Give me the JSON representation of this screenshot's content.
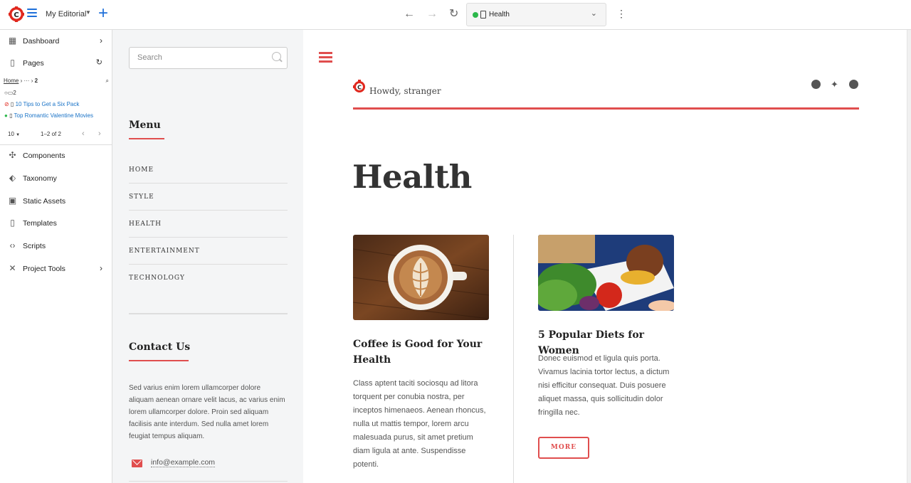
{
  "toolbar": {
    "site_name": "My Editorial",
    "address_label": "Health"
  },
  "sidebar": {
    "items": [
      {
        "label": "Dashboard"
      },
      {
        "label": "Pages"
      },
      {
        "label": "Components"
      },
      {
        "label": "Taxonomy"
      },
      {
        "label": "Static Assets"
      },
      {
        "label": "Templates"
      },
      {
        "label": "Scripts"
      },
      {
        "label": "Project Tools"
      }
    ],
    "breadcrumb": {
      "home": "Home",
      "ellipsis": "···",
      "current": "2"
    },
    "tree": {
      "folder": "2",
      "pages": [
        "10 Tips to Get a Six Pack",
        "Top Romantic Valentine Movies"
      ]
    },
    "pager": {
      "per_page": "10",
      "range": "1–2 of 2"
    }
  },
  "site": {
    "search_placeholder": "Search",
    "menu_title": "Menu",
    "menu_items": [
      "HOME",
      "STYLE",
      "HEALTH",
      "ENTERTAINMENT",
      "TECHNOLOGY"
    ],
    "contact_title": "Contact Us",
    "contact_text": "Sed varius enim lorem ullamcorper dolore aliquam aenean ornare velit lacus, ac varius enim lorem ullamcorper dolore. Proin sed aliquam facilisis ante interdum. Sed nulla amet lorem feugiat tempus aliquam.",
    "email": "info@example.com",
    "greeting": "Howdy, stranger",
    "page_title": "Health",
    "articles": [
      {
        "title": "Coffee is Good for Your Health",
        "body": "Class aptent taciti sociosqu ad litora torquent per conubia nostra, per inceptos himenaeos. Aenean rhoncus, nulla ut mattis tempor, lorem arcu malesuada purus, sit amet pretium diam ligula at ante. Suspendisse potenti."
      },
      {
        "title": "5 Popular Diets for Women",
        "body": "Donec euismod et ligula quis porta. Vivamus lacinia tortor lectus, a dictum nisi efficitur consequat. Duis posuere aliquet massa, quis sollicitudin dolor fringilla nec.",
        "button": "MORE"
      }
    ]
  },
  "colors": {
    "accent": "#e04e4e",
    "brand_blue": "#1e6fd9",
    "live_green": "#2cb84b"
  }
}
